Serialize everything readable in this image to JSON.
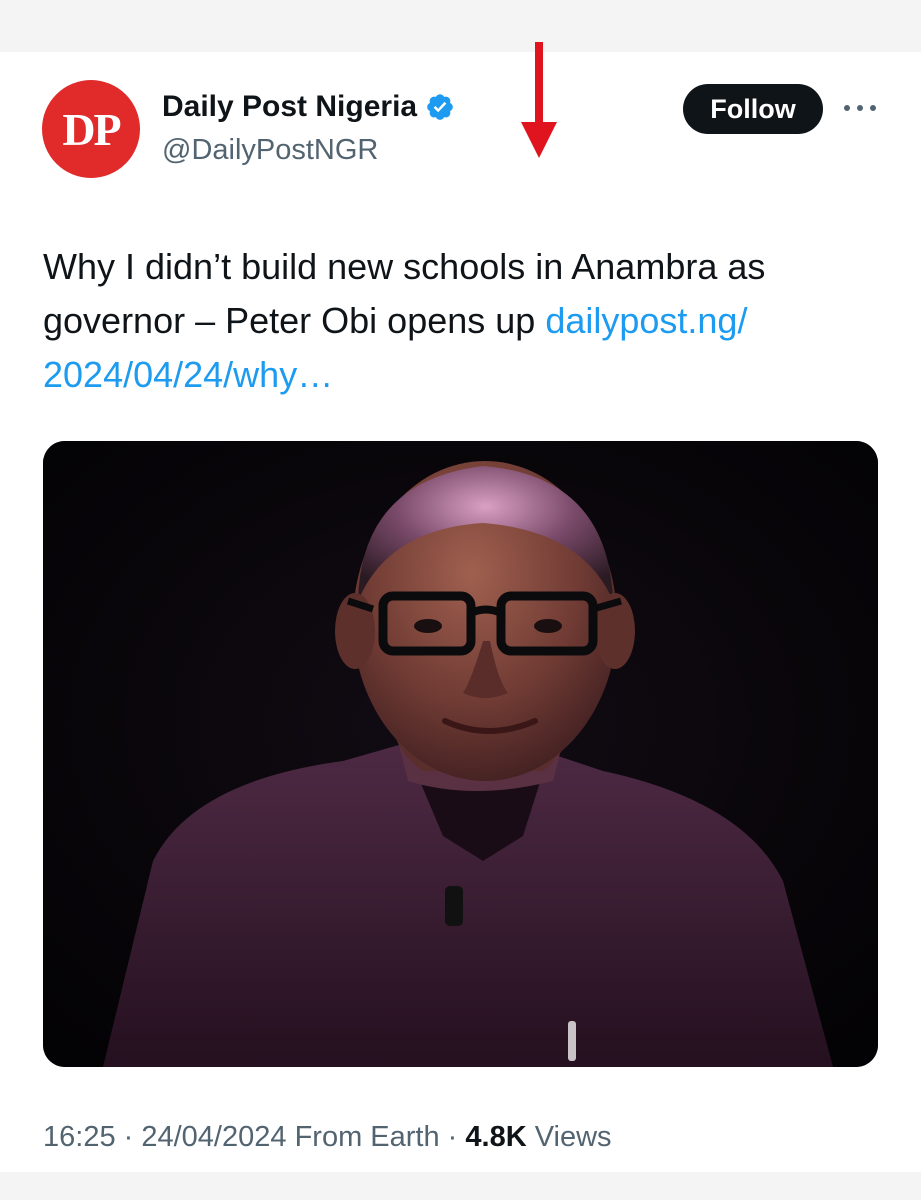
{
  "account": {
    "avatar_text": "DP",
    "display_name": "Daily Post Nigeria",
    "handle": "@DailyPostNGR",
    "verified": true
  },
  "actions": {
    "follow_label": "Follow",
    "more_icon": "more-horizontal-icon"
  },
  "tweet": {
    "text": "Why I didn’t build new schools in Anambra as governor – Peter Obi opens up ",
    "link_text": "dailypost.ng/ 2024/04/24/why…"
  },
  "meta": {
    "time": "16:25",
    "separator": " · ",
    "date": "24/04/2024",
    "source": "From Earth",
    "views_count": "4.8K",
    "views_label": "Views"
  },
  "colors": {
    "avatar_bg": "#e12a2a",
    "link": "#1d9bf0",
    "verified": "#1d9bf0",
    "arrow": "#e0141e",
    "follow_bg": "#0f1419"
  }
}
